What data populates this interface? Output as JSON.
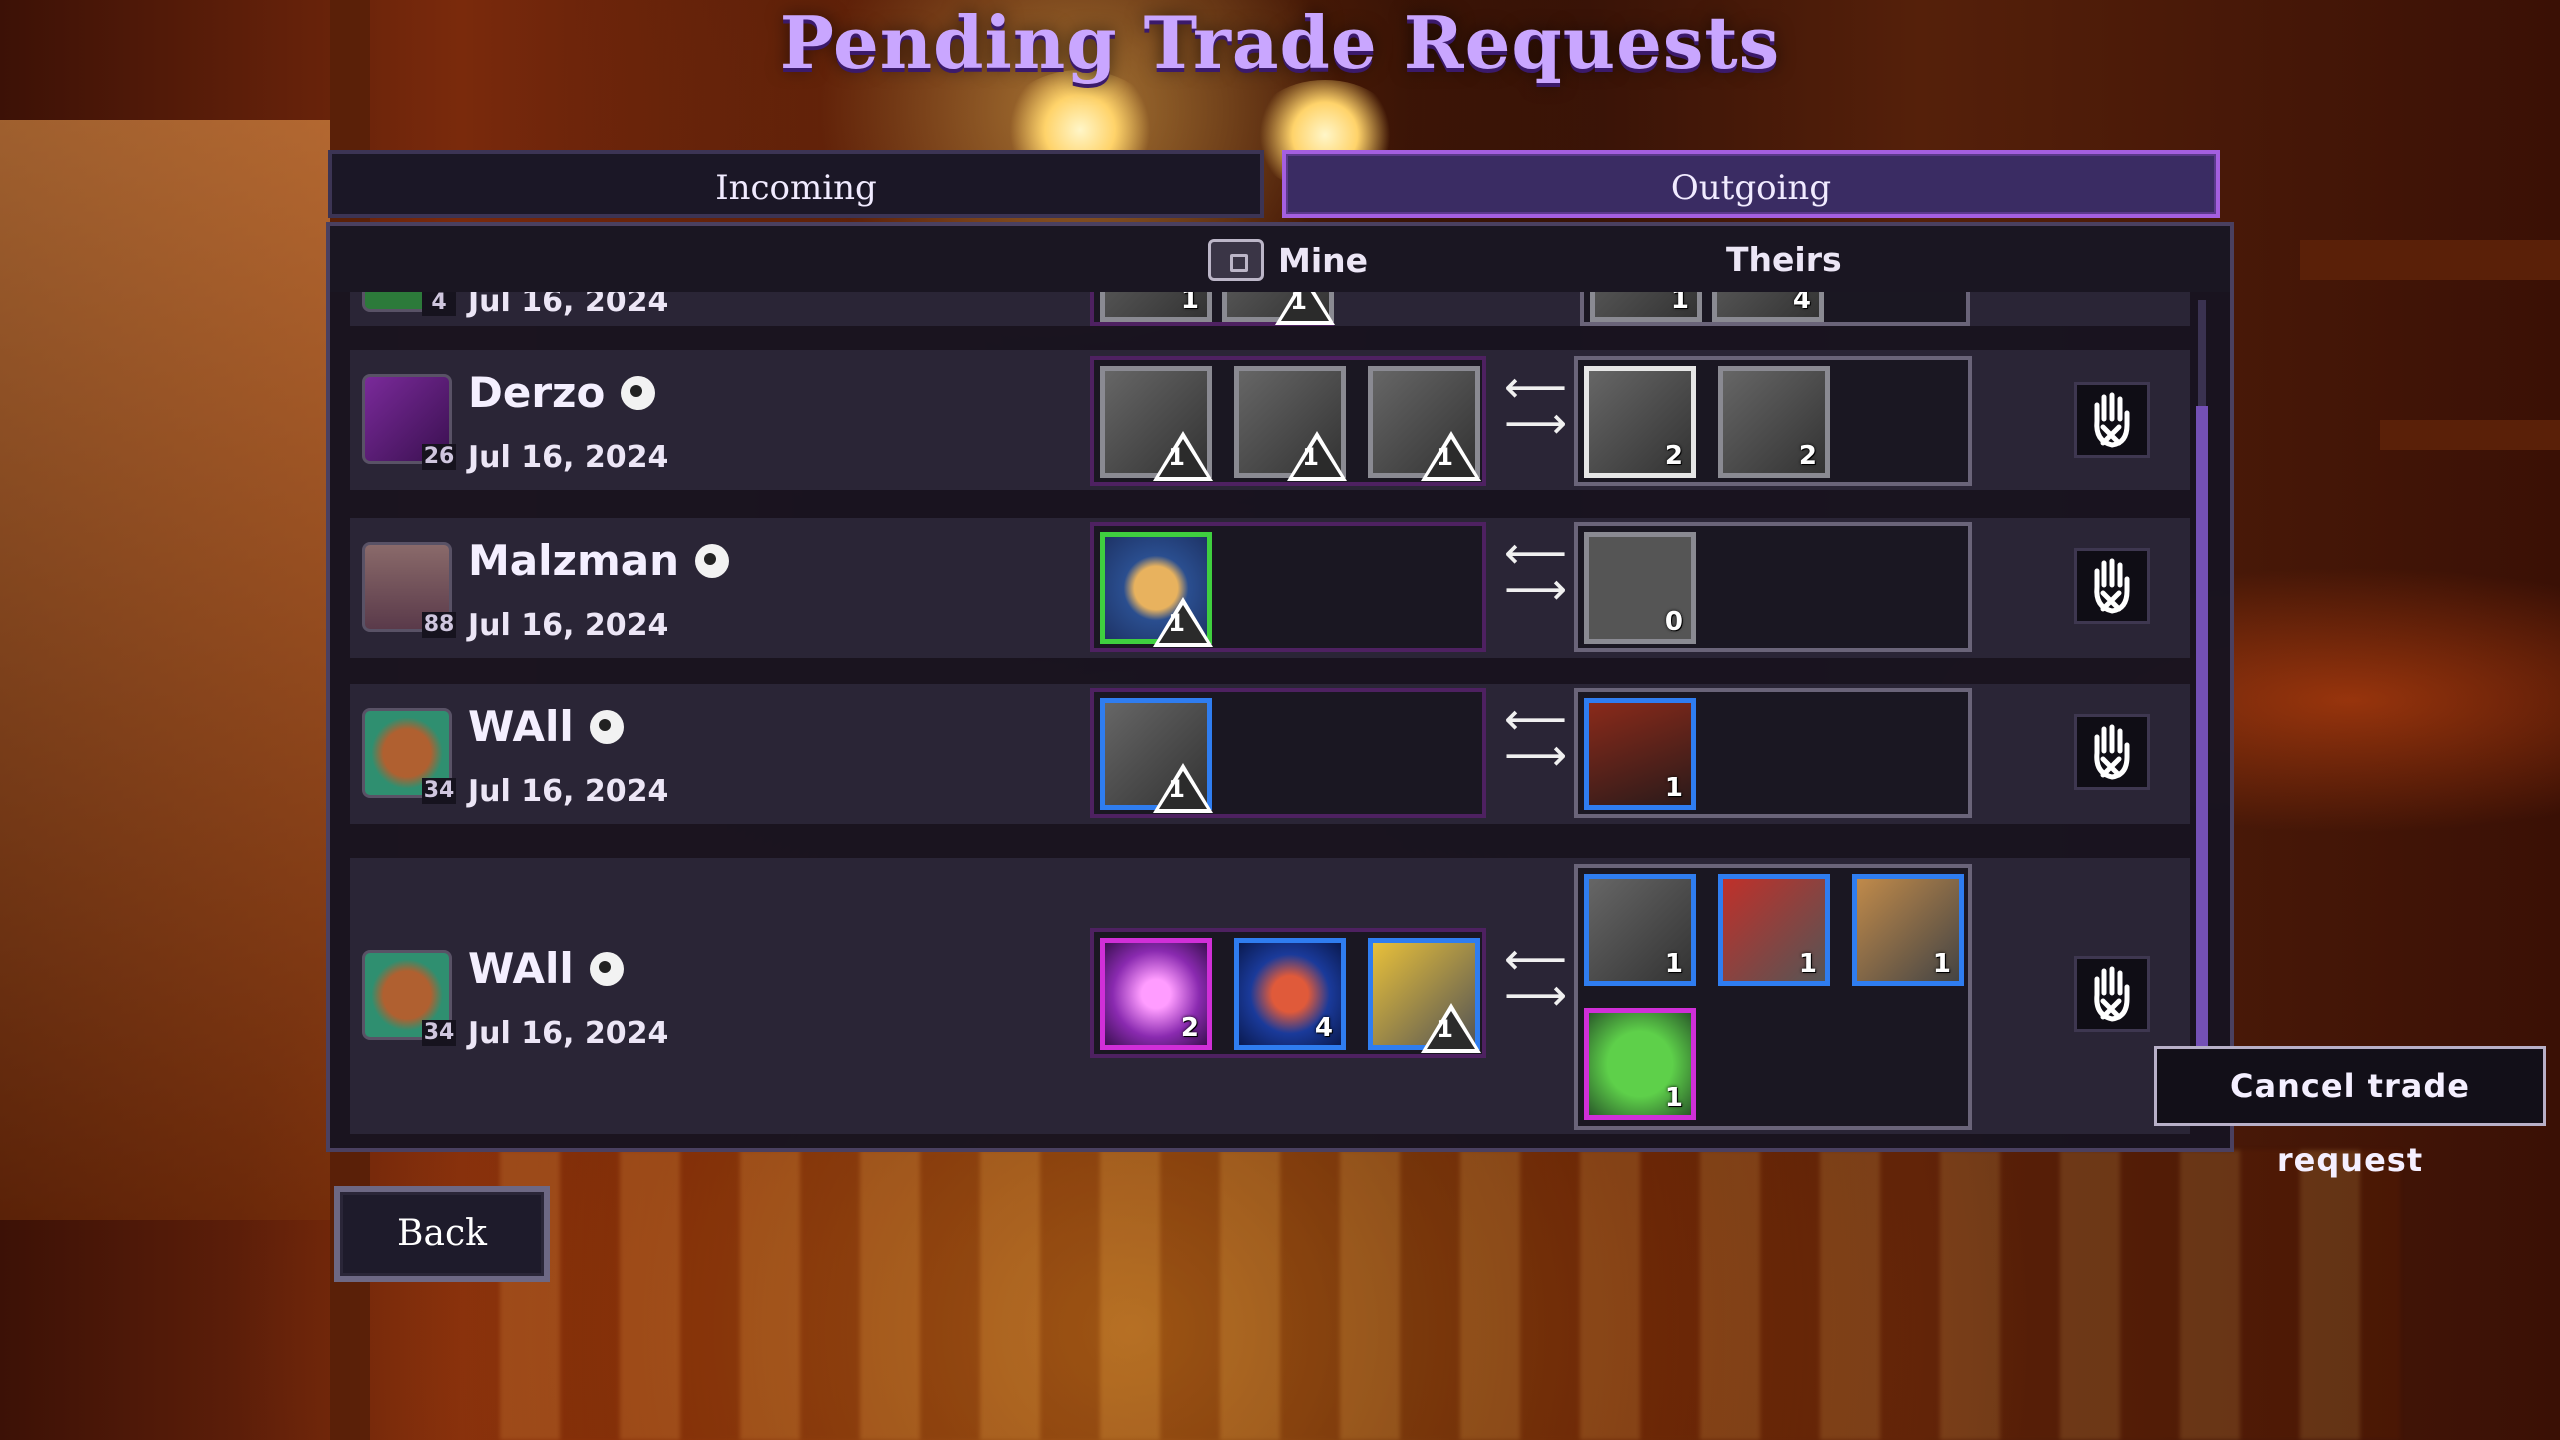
{
  "title": "Pending Trade Requests",
  "tabs": {
    "incoming": "Incoming",
    "outgoing": "Outgoing"
  },
  "columns": {
    "mine": "Mine",
    "theirs": "Theirs"
  },
  "rows": [
    {
      "name": "",
      "level": "4",
      "date": "Jul 16, 2024",
      "mine": [
        "1",
        "1"
      ],
      "theirs": [
        "1",
        "4"
      ]
    },
    {
      "name": "Derzo",
      "level": "26",
      "date": "Jul 16, 2024",
      "mine": [
        "1",
        "1",
        "1"
      ],
      "theirs": [
        "2",
        "2"
      ]
    },
    {
      "name": "Malzman",
      "level": "88",
      "date": "Jul 16, 2024",
      "mine": [
        "1"
      ],
      "theirs": [
        "0"
      ]
    },
    {
      "name": "WAll",
      "level": "34",
      "date": "Jul 16, 2024",
      "mine": [
        "1"
      ],
      "theirs": [
        "1"
      ]
    },
    {
      "name": "WAll",
      "level": "34",
      "date": "Jul 16, 2024",
      "mine": [
        "2",
        "4",
        "1"
      ],
      "theirs": [
        "1",
        "1",
        "1",
        "1"
      ]
    }
  ],
  "tooltip": "Cancel trade request",
  "back_label": "Back",
  "icons": {
    "steam": "steam-icon",
    "cancel": "hand-cancel-icon",
    "chest": "chest-icon",
    "warning": "warning-triangle-icon"
  },
  "colors": {
    "accent": "#a45fe0",
    "title": "#c9a6ff",
    "rarity_green": "#3fcf3f",
    "rarity_blue": "#2f7df0",
    "rarity_purple": "#d02fd8"
  }
}
